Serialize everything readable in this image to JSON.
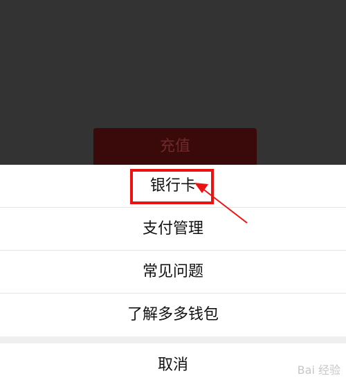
{
  "background": {
    "recharge_label": "充值"
  },
  "action_sheet": {
    "items": [
      {
        "label": "银行卡"
      },
      {
        "label": "支付管理"
      },
      {
        "label": "常见问题"
      },
      {
        "label": "了解多多钱包"
      }
    ],
    "cancel_label": "取消"
  },
  "annotation": {
    "highlight_color": "#ee1111"
  },
  "watermark": {
    "text": "Bai 经验"
  }
}
